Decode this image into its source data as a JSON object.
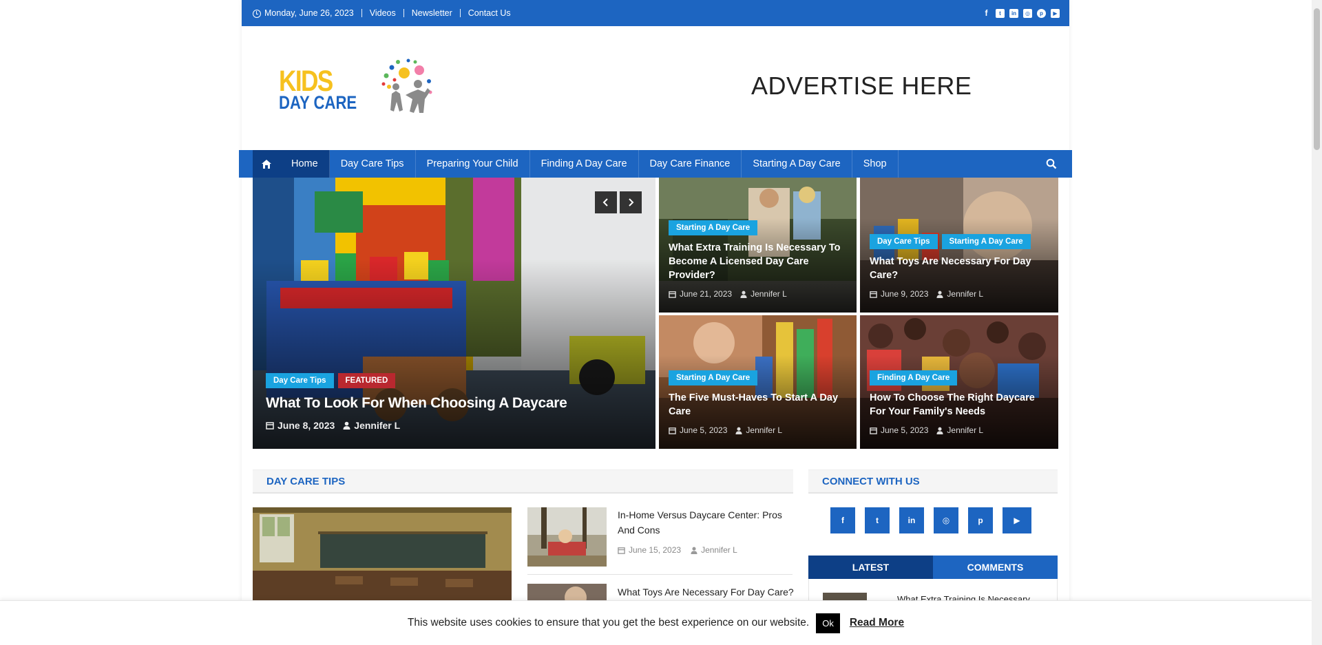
{
  "topbar": {
    "date": "Monday, June 26, 2023",
    "links": [
      "Videos",
      "Newsletter",
      "Contact Us"
    ],
    "social": [
      "facebook-icon",
      "twitter-icon",
      "linkedin-icon",
      "instagram-icon",
      "pinterest-icon",
      "youtube-icon"
    ]
  },
  "logo": {
    "line1": "KIDS",
    "line2": "DAY CARE"
  },
  "advert": "ADVERTISE HERE",
  "nav": {
    "items": [
      "Home",
      "Day Care Tips",
      "Preparing Your Child",
      "Finding A Day Care",
      "Day Care Finance",
      "Starting A Day Care",
      "Shop"
    ]
  },
  "hero": {
    "main": {
      "tags": [
        "Day Care Tips",
        "FEATURED"
      ],
      "title": "What To Look For When Choosing A Daycare",
      "date": "June 8, 2023",
      "author": "Jennifer L"
    },
    "cards": [
      {
        "tags": [
          "Starting A Day Care"
        ],
        "title": "What Extra Training Is Necessary To Become A Licensed Day Care Provider?",
        "date": "June 21, 2023",
        "author": "Jennifer L"
      },
      {
        "tags": [
          "Day Care Tips",
          "Starting A Day Care"
        ],
        "title": "What Toys Are Necessary For Day Care?",
        "date": "June 9, 2023",
        "author": "Jennifer L"
      },
      {
        "tags": [
          "Starting A Day Care"
        ],
        "title": "The Five Must-Haves To Start A Day Care",
        "date": "June 5, 2023",
        "author": "Jennifer L"
      },
      {
        "tags": [
          "Finding A Day Care"
        ],
        "title": "How To Choose The Right Daycare For Your Family's Needs",
        "date": "June 5, 2023",
        "author": "Jennifer L"
      }
    ]
  },
  "section": {
    "title": "DAY CARE TIPS",
    "posts": [
      {
        "title": "In-Home Versus Daycare Center: Pros And Cons",
        "date": "June 15, 2023",
        "author": "Jennifer L"
      },
      {
        "title": "What Toys Are Necessary For Day Care?"
      }
    ]
  },
  "sidebar": {
    "title": "CONNECT WITH US",
    "social": [
      "facebook-icon",
      "twitter-icon",
      "linkedin-icon",
      "instagram-icon",
      "pinterest-icon",
      "youtube-icon"
    ],
    "tabs": [
      "LATEST",
      "COMMENTS"
    ],
    "latest_preview": "What Extra Training Is Necessary"
  },
  "cookie": {
    "message": "This website uses cookies to ensure that you get the best experience on our website.",
    "ok": "Ok",
    "more": "Read More"
  },
  "colors": {
    "brand": "#1d65c1",
    "brand_dark": "#0d3f86",
    "tag_blue": "#1aa3e0",
    "tag_red": "#b9282f"
  }
}
